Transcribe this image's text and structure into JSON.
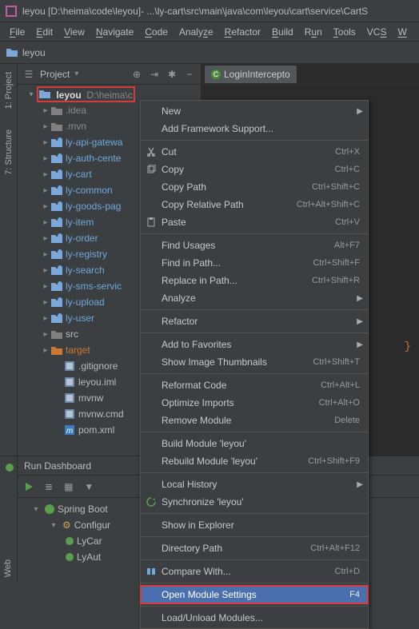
{
  "title": {
    "project": "leyou",
    "path_bracket": "[D:\\heima\\code\\leyou]",
    "tail": " - ...\\ly-cart\\src\\main\\java\\com\\leyou\\cart\\service\\CartS"
  },
  "menubar": [
    "File",
    "Edit",
    "View",
    "Navigate",
    "Code",
    "Analyze",
    "Refactor",
    "Build",
    "Run",
    "Tools",
    "VCS",
    "W"
  ],
  "breadcrumb": {
    "root": "leyou"
  },
  "project_panel": {
    "header_label": "Project",
    "root_name": "leyou",
    "root_path": "D:\\heima\\c",
    "items": [
      {
        "label": ".idea",
        "type": "folder-dim"
      },
      {
        "label": ".mvn",
        "type": "folder-dim"
      },
      {
        "label": "ly-api-gatewa",
        "type": "module"
      },
      {
        "label": "ly-auth-cente",
        "type": "module"
      },
      {
        "label": "ly-cart",
        "type": "module"
      },
      {
        "label": "ly-common",
        "type": "module"
      },
      {
        "label": "ly-goods-pag",
        "type": "module"
      },
      {
        "label": "ly-item",
        "type": "module"
      },
      {
        "label": "ly-order",
        "type": "module"
      },
      {
        "label": "ly-registry",
        "type": "module"
      },
      {
        "label": "ly-search",
        "type": "module"
      },
      {
        "label": "ly-sms-servic",
        "type": "module"
      },
      {
        "label": "ly-upload",
        "type": "module"
      },
      {
        "label": "ly-user",
        "type": "module"
      },
      {
        "label": "src",
        "type": "folder"
      },
      {
        "label": "target",
        "type": "target"
      },
      {
        "label": ".gitignore",
        "type": "file",
        "indent": 3
      },
      {
        "label": "leyou.iml",
        "type": "file",
        "indent": 3
      },
      {
        "label": "mvnw",
        "type": "file",
        "indent": 3
      },
      {
        "label": "mvnw.cmd",
        "type": "file",
        "indent": 3
      },
      {
        "label": "pom.xml",
        "type": "maven",
        "indent": 3
      }
    ]
  },
  "editor": {
    "tab": "LoginIntercepto"
  },
  "context_menu": [
    {
      "label": "New",
      "submenu": true
    },
    {
      "label": "Add Framework Support..."
    },
    {
      "sep": true
    },
    {
      "icon": "cut",
      "label": "Cut",
      "short": "Ctrl+X"
    },
    {
      "icon": "copy",
      "label": "Copy",
      "short": "Ctrl+C"
    },
    {
      "label": "Copy Path",
      "short": "Ctrl+Shift+C"
    },
    {
      "label": "Copy Relative Path",
      "short": "Ctrl+Alt+Shift+C"
    },
    {
      "icon": "paste",
      "label": "Paste",
      "short": "Ctrl+V"
    },
    {
      "sep": true
    },
    {
      "label": "Find Usages",
      "short": "Alt+F7"
    },
    {
      "label": "Find in Path...",
      "short": "Ctrl+Shift+F"
    },
    {
      "label": "Replace in Path...",
      "short": "Ctrl+Shift+R"
    },
    {
      "label": "Analyze",
      "submenu": true
    },
    {
      "sep": true
    },
    {
      "label": "Refactor",
      "submenu": true
    },
    {
      "sep": true
    },
    {
      "label": "Add to Favorites",
      "submenu": true
    },
    {
      "label": "Show Image Thumbnails",
      "short": "Ctrl+Shift+T"
    },
    {
      "sep": true
    },
    {
      "label": "Reformat Code",
      "short": "Ctrl+Alt+L"
    },
    {
      "label": "Optimize Imports",
      "short": "Ctrl+Alt+O"
    },
    {
      "label": "Remove Module",
      "short": "Delete"
    },
    {
      "sep": true
    },
    {
      "label": "Build Module 'leyou'"
    },
    {
      "label": "Rebuild Module 'leyou'",
      "short": "Ctrl+Shift+F9"
    },
    {
      "sep": true
    },
    {
      "label": "Local History",
      "submenu": true
    },
    {
      "icon": "sync",
      "label": "Synchronize 'leyou'"
    },
    {
      "sep": true
    },
    {
      "label": "Show in Explorer"
    },
    {
      "sep": true
    },
    {
      "label": "Directory Path",
      "short": "Ctrl+Alt+F12"
    },
    {
      "sep": true
    },
    {
      "icon": "compare",
      "label": "Compare With...",
      "short": "Ctrl+D"
    },
    {
      "sep": true
    },
    {
      "label": "Open Module Settings",
      "short": "F4",
      "selected": true
    },
    {
      "sep": true
    },
    {
      "label": "Load/Unload Modules..."
    }
  ],
  "sidebar": {
    "project": "1: Project",
    "structure": "7: Structure",
    "web": "Web"
  },
  "run_dashboard": {
    "title": "Run Dashboard",
    "root": "Spring Boot",
    "config": "Configur",
    "apps": [
      "LyCar",
      "LyAut"
    ]
  }
}
